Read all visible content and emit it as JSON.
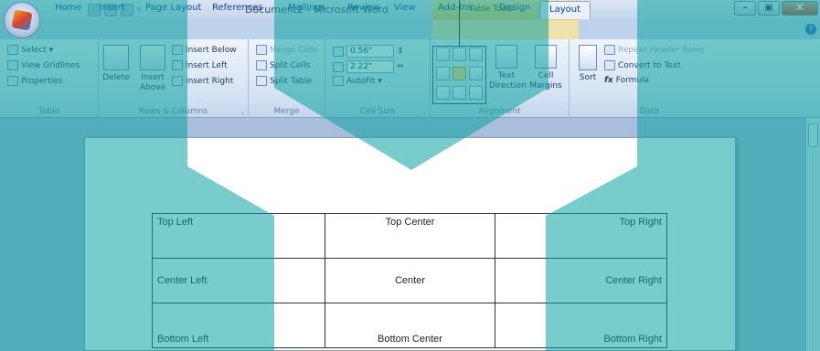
{
  "window": {
    "title": "Document2 - Microsoft Word",
    "context_tab": "Table Tools",
    "controls": [
      "–",
      "▣",
      "X"
    ]
  },
  "tabs": [
    {
      "label": "Home"
    },
    {
      "label": "Insert"
    },
    {
      "label": "Page Layout"
    },
    {
      "label": "References"
    },
    {
      "label": "Mailings"
    },
    {
      "label": "Review"
    },
    {
      "label": "View"
    },
    {
      "label": "Add-Ins"
    },
    {
      "label": "Design"
    },
    {
      "label": "Layout"
    }
  ],
  "ribbon": {
    "table": {
      "label": "Table",
      "select": "Select ▾",
      "view_gridlines": "View Gridlines",
      "properties": "Properties"
    },
    "rows_columns": {
      "label": "Rows & Columns",
      "delete": "Delete",
      "insert_above_1": "Insert",
      "insert_above_2": "Above",
      "insert_below": "Insert Below",
      "insert_left": "Insert Left",
      "insert_right": "Insert Right"
    },
    "merge": {
      "label": "Merge",
      "merge_cells": "Merge Cells",
      "split_cells": "Split Cells",
      "split_table": "Split Table"
    },
    "cell_size": {
      "label": "Cell Size",
      "height": "0.56\"",
      "width": "2.22\"",
      "autofit": "AutoFit ▾"
    },
    "alignment": {
      "label": "Alignment",
      "text_direction_1": "Text",
      "text_direction_2": "Direction",
      "cell_margins_1": "Cell",
      "cell_margins_2": "Margins"
    },
    "data": {
      "label": "Data",
      "sort": "Sort",
      "repeat_header_rows": "Repeat Header Rows",
      "convert_to_text": "Convert to Text",
      "formula": "Formula"
    }
  },
  "document_table": [
    [
      "Top Left",
      "Top Center",
      "Top Right"
    ],
    [
      "Center Left",
      "Center",
      "Center Right"
    ],
    [
      "Bottom Left",
      "Bottom Center",
      "Bottom Right"
    ]
  ],
  "colors": {
    "watermark": "#0aa3a1",
    "ribbon_bg": "#dbe6f4",
    "context_tab": "#e9c862"
  }
}
